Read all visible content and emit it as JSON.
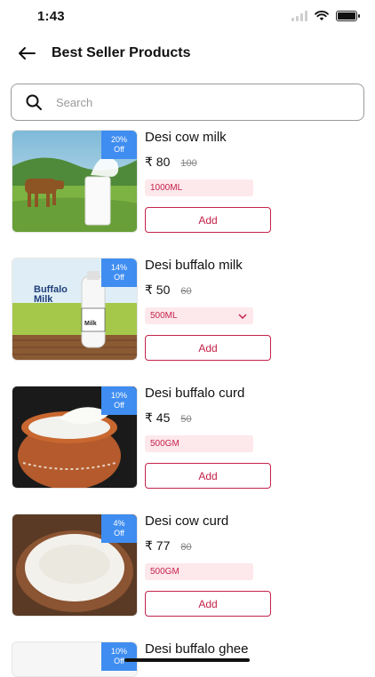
{
  "status_bar": {
    "time": "1:43"
  },
  "header": {
    "title": "Best Seller Products"
  },
  "search": {
    "placeholder": "Search"
  },
  "products": [
    {
      "name": "Desi cow milk",
      "price": "₹ 80",
      "mrp": "100",
      "discount_pct": "20%",
      "discount_label": "Off",
      "variant": "1000ML",
      "has_dropdown": false,
      "add_label": "Add"
    },
    {
      "name": "Desi buffalo milk",
      "price": "₹ 50",
      "mrp": "60",
      "discount_pct": "14%",
      "discount_label": "Off",
      "variant": "500ML",
      "has_dropdown": true,
      "add_label": "Add",
      "image_text": {
        "line1": "Buffalo",
        "line2": "Milk",
        "bottle": "Milk"
      }
    },
    {
      "name": "Desi buffalo curd",
      "price": "₹ 45",
      "mrp": "50",
      "discount_pct": "10%",
      "discount_label": "Off",
      "variant": "500GM",
      "has_dropdown": false,
      "add_label": "Add"
    },
    {
      "name": "Desi cow curd",
      "price": "₹ 77",
      "mrp": "80",
      "discount_pct": "4%",
      "discount_label": "Off",
      "variant": "500GM",
      "has_dropdown": false,
      "add_label": "Add"
    },
    {
      "name": "Desi buffalo ghee",
      "discount_pct": "10%",
      "discount_label": "Off"
    }
  ],
  "colors": {
    "accent": "#c4224a",
    "badge": "#3f8df0",
    "variant_bg": "#fde8ec"
  }
}
